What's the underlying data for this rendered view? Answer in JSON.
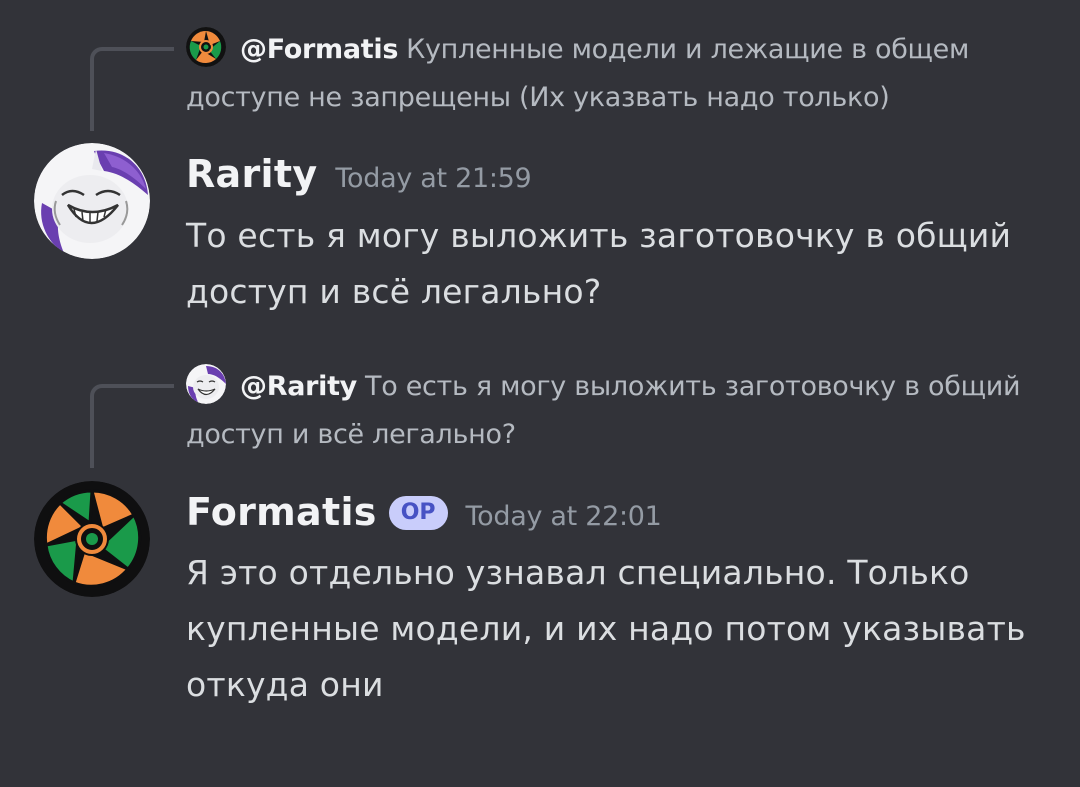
{
  "messages": [
    {
      "reply": {
        "author": "@Formatis",
        "text": "Купленные модели и лежащие в общем доступе не запрещены (Их указвать надо только)"
      },
      "author": "Rarity",
      "timestamp": "Today at 21:59",
      "content": "То есть я могу выложить заготовочку в общий доступ и всё легально?"
    },
    {
      "reply": {
        "author": "@Rarity",
        "text": "То есть я могу выложить заготовочку в общий доступ и всё легально?"
      },
      "author": "Formatis",
      "badge": "OP",
      "timestamp": "Today at 22:01",
      "content": "Я это отдельно узнавал специально. Только купленные модели, и их надо потом указывать откуда они"
    }
  ],
  "colors": {
    "background": "#323339",
    "username": "#f2f3f5",
    "timestamp": "#949ba4",
    "badge_bg": "#c9cdfb",
    "badge_text": "#4752c4",
    "formatis_orange": "#f08a3c",
    "formatis_green": "#1a9a4a"
  },
  "icons": {
    "formatis_avatar": "formatis-shutter-logo-icon",
    "rarity_avatar": "rarity-pony-avatar-icon"
  }
}
